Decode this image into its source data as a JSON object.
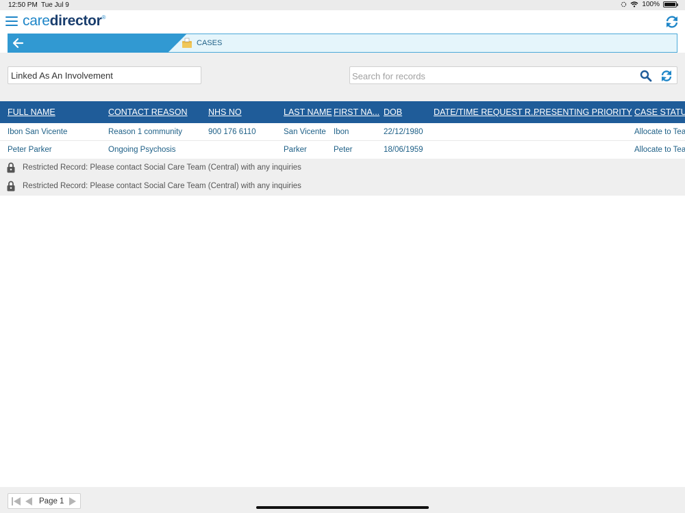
{
  "status": {
    "time": "12:50 PM",
    "date": "Tue Jul 9",
    "battery": "100%"
  },
  "header": {
    "logo_light": "care",
    "logo_bold": "director",
    "logo_mark": "®"
  },
  "breadcrumb": {
    "label": "CASES"
  },
  "filter": {
    "view": "Linked As An Involvement"
  },
  "search": {
    "placeholder": "Search for records",
    "value": ""
  },
  "table": {
    "columns": [
      "FULL NAME",
      "CONTACT REASON",
      "NHS NO",
      "LAST NAME",
      "FIRST NA...",
      "DOB",
      "DATE/TIME REQUEST R...",
      "PRESENTING PRIORITY",
      "CASE STATUS"
    ],
    "rows": [
      [
        "Ibon San Vicente",
        "Reason 1 community",
        "900 176 6110",
        "San Vicente",
        "Ibon",
        "22/12/1980",
        "",
        "",
        "Allocate to Team"
      ],
      [
        "Peter Parker",
        "Ongoing Psychosis",
        "",
        "Parker",
        "Peter",
        "18/06/1959",
        "",
        "",
        "Allocate to Team"
      ]
    ],
    "restricted": [
      "Restricted Record: Please contact Social Care Team (Central) with any inquiries",
      "Restricted Record: Please contact Social Care Team (Central) with any inquiries"
    ]
  },
  "pager": {
    "label": "Page 1"
  },
  "colors": {
    "accent": "#1f86c8",
    "header_bar": "#1f5c99",
    "link_text": "#1d5f86"
  }
}
